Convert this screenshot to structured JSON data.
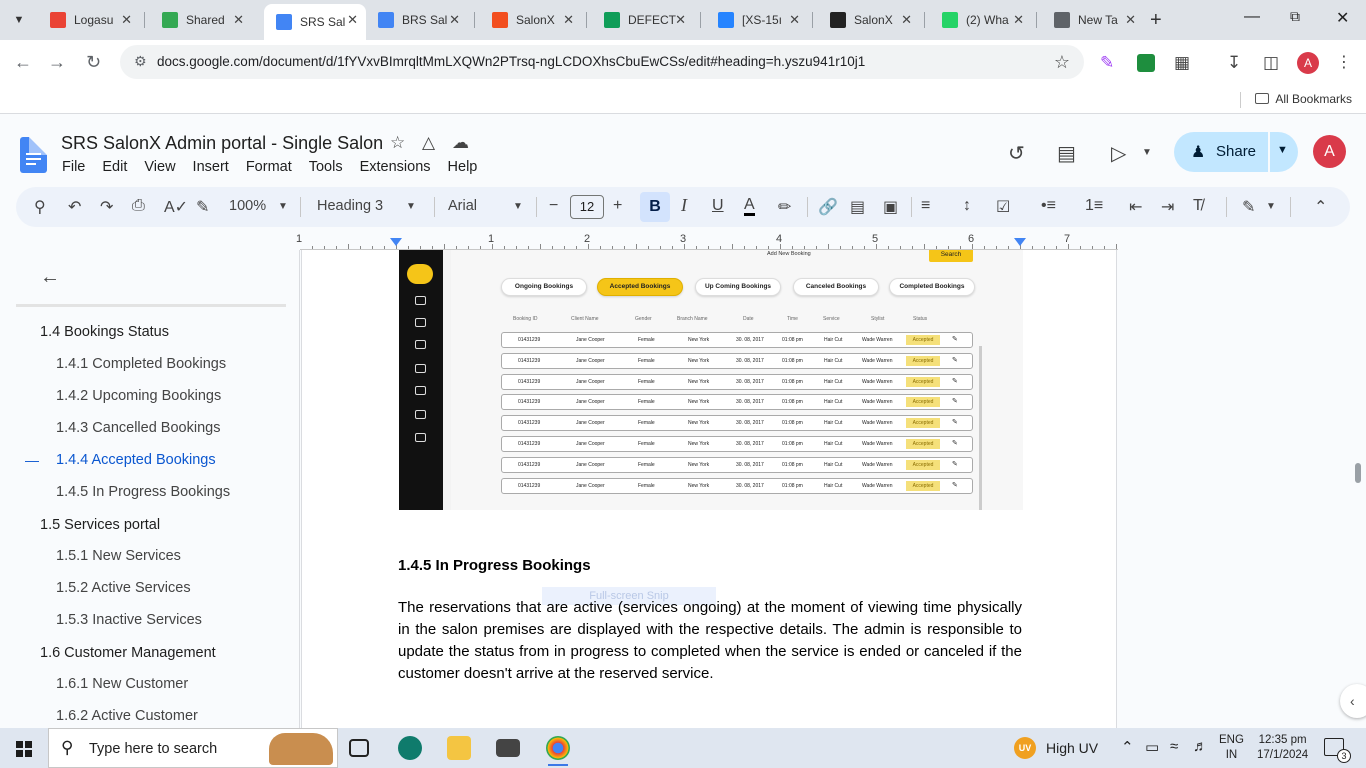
{
  "browser": {
    "tabs": [
      {
        "title": "Logasu",
        "favicon": "gmail-icon",
        "color": "#ea4335",
        "active": false
      },
      {
        "title": "Shared",
        "favicon": "drive-icon",
        "color": "#34a853",
        "active": false
      },
      {
        "title": "SRS Sal",
        "favicon": "docs-icon",
        "color": "#4285f4",
        "active": true
      },
      {
        "title": "BRS Sal",
        "favicon": "docs-icon",
        "color": "#4285f4",
        "active": false
      },
      {
        "title": "SalonX",
        "favicon": "figma-icon",
        "color": "#f24e1e",
        "active": false
      },
      {
        "title": "DEFECT",
        "favicon": "sheets-icon",
        "color": "#0f9d58",
        "active": false
      },
      {
        "title": "[XS-15ı",
        "favicon": "jira-icon",
        "color": "#2684ff",
        "active": false
      },
      {
        "title": "SalonX",
        "favicon": "angular-icon",
        "color": "#222222",
        "active": false
      },
      {
        "title": "(2) Wha",
        "favicon": "whatsapp-icon",
        "color": "#25d366",
        "active": false
      },
      {
        "title": "New Ta",
        "favicon": "chrome-icon",
        "color": "#5f6368",
        "active": false
      }
    ],
    "url": "docs.google.com/document/d/1fYVxvBImrqltMmLXQWn2PTrsq-ngLCDOXhsCbuEwCSs/edit#heading=h.yszu941r10j1",
    "bookmarks_label": "All Bookmarks",
    "profile_initial": "A"
  },
  "docs": {
    "title": "SRS SalonX Admin portal - Single Salon",
    "menu": [
      "File",
      "Edit",
      "View",
      "Insert",
      "Format",
      "Tools",
      "Extensions",
      "Help"
    ],
    "share_label": "Share",
    "profile_initial": "A",
    "toolbar": {
      "zoom": "100%",
      "style": "Heading 3",
      "font": "Arial",
      "font_size": "12",
      "bold": "B",
      "italic": "I",
      "underline": "U",
      "text_color": "A"
    },
    "ruler_numbers": [
      "1",
      "1",
      "2",
      "3",
      "4",
      "5",
      "6",
      "7"
    ]
  },
  "outline": {
    "items": [
      {
        "label": "1.4 Bookings Status",
        "level": 2,
        "current": false
      },
      {
        "label": "1.4.1 Completed Bookings",
        "level": 3,
        "current": false
      },
      {
        "label": "1.4.2 Upcoming Bookings",
        "level": 3,
        "current": false
      },
      {
        "label": "1.4.3 Cancelled Bookings",
        "level": 3,
        "current": false
      },
      {
        "label": "1.4.4 Accepted Bookings",
        "level": 3,
        "current": true
      },
      {
        "label": "1.4.5 In Progress Bookings",
        "level": 3,
        "current": false
      },
      {
        "label": "1.5 Services portal",
        "level": 2,
        "current": false
      },
      {
        "label": "1.5.1 New Services",
        "level": 3,
        "current": false
      },
      {
        "label": "1.5.2 Active Services",
        "level": 3,
        "current": false
      },
      {
        "label": "1.5.3 Inactive Services",
        "level": 3,
        "current": false
      },
      {
        "label": "1.6 Customer Management",
        "level": 2,
        "current": false
      },
      {
        "label": "1.6.1 New Customer",
        "level": 3,
        "current": false
      },
      {
        "label": "1.6.2 Active Customer",
        "level": 3,
        "current": false
      }
    ]
  },
  "embedded_screenshot": {
    "add_booking": "Add New Booking",
    "search": "Search",
    "tabs": [
      "Ongoing Bookings",
      "Accepted Bookings",
      "Up Coming Bookings",
      "Canceled Bookings",
      "Completed Bookings"
    ],
    "selected_tab": 1,
    "columns": [
      "Booking ID",
      "Client Name",
      "Gender",
      "Branch Name",
      "Date",
      "Time",
      "Service",
      "Stylist",
      "Status"
    ],
    "rows": [
      [
        "01431239",
        "Jane Cooper",
        "Female",
        "New York",
        "30. 08, 2017",
        "01:08 pm",
        "Hair Cut",
        "Wade Warren",
        "Accepted"
      ],
      [
        "01431239",
        "Jane Cooper",
        "Female",
        "New York",
        "30. 08, 2017",
        "01:08 pm",
        "Hair Cut",
        "Wade Warren",
        "Accepted"
      ],
      [
        "01431239",
        "Jane Cooper",
        "Female",
        "New York",
        "30. 08, 2017",
        "01:08 pm",
        "Hair Cut",
        "Wade Warren",
        "Accepted"
      ],
      [
        "01431239",
        "Jane Cooper",
        "Female",
        "New York",
        "30. 08, 2017",
        "01:08 pm",
        "Hair Cut",
        "Wade Warren",
        "Accepted"
      ],
      [
        "01431239",
        "Jane Cooper",
        "Female",
        "New York",
        "30. 08, 2017",
        "01:08 pm",
        "Hair Cut",
        "Wade Warren",
        "Accepted"
      ],
      [
        "01431239",
        "Jane Cooper",
        "Female",
        "New York",
        "30. 08, 2017",
        "01:08 pm",
        "Hair Cut",
        "Wade Warren",
        "Accepted"
      ],
      [
        "01431239",
        "Jane Cooper",
        "Female",
        "New York",
        "30. 08, 2017",
        "01:08 pm",
        "Hair Cut",
        "Wade Warren",
        "Accepted"
      ],
      [
        "01431239",
        "Jane Cooper",
        "Female",
        "New York",
        "30. 08, 2017",
        "01:08 pm",
        "Hair Cut",
        "Wade Warren",
        "Accepted"
      ]
    ]
  },
  "content": {
    "heading": "1.4.5 In Progress Bookings",
    "ghost_label": "Full-screen Snip",
    "paragraph": "The reservations that are active (services ongoing)  at the moment of viewing time physically in the salon premises are displayed with the respective details. The admin is responsible to update the status from in progress to completed when the service is ended or canceled if the customer doesn't arrive at the reserved service."
  },
  "taskbar": {
    "search_placeholder": "Type here to search",
    "weather": "High UV",
    "uv_badge": "UV",
    "lang_top": "ENG",
    "lang_bottom": "IN",
    "time": "12:35 pm",
    "date": "17/1/2024",
    "notifications": "3"
  }
}
